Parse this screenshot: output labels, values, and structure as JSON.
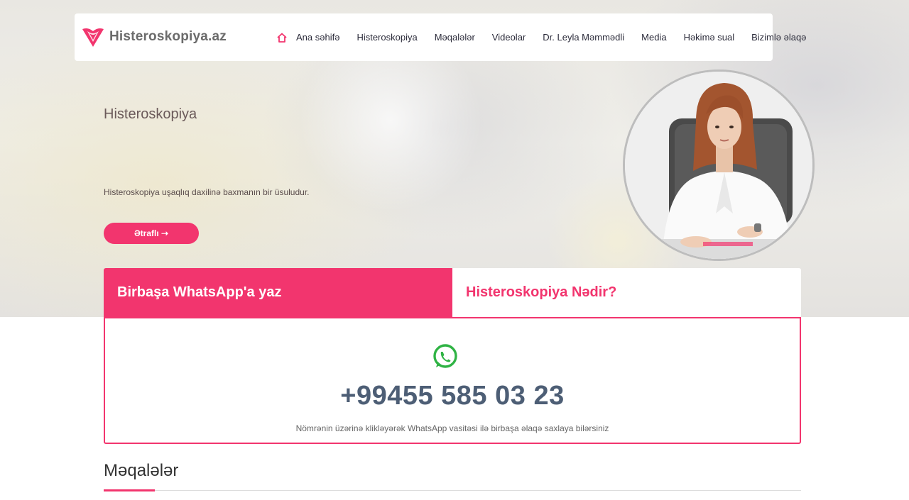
{
  "brand": {
    "name": "Histeroskopiya.az",
    "accent_color": "#f2356e"
  },
  "nav": {
    "items": [
      {
        "label": "Ana səhifə",
        "icon": "home-icon"
      },
      {
        "label": "Histeroskopiya"
      },
      {
        "label": "Məqalələr"
      },
      {
        "label": "Videolar"
      },
      {
        "label": "Dr. Leyla Məmmədli"
      },
      {
        "label": "Media"
      },
      {
        "label": "Həkimə sual"
      },
      {
        "label": "Bizimlə əlaqə"
      }
    ]
  },
  "hero": {
    "title": "Histeroskopiya",
    "description": "Histeroskopiya uşaqlıq daxilinə baxmanın bir üsuludur.",
    "button_label": "Ətraflı ➝"
  },
  "tabs": {
    "whatsapp_label": "Birbaşa WhatsApp'a yaz",
    "what_is_label": "Histeroskopiya Nədir?"
  },
  "whatsapp": {
    "phone": "+99455 585 03 23",
    "note": "Nömrənin üzərinə klikləyərək WhatsApp vasitəsi ilə birbaşa əlaqə saxlaya bilərsiniz",
    "icon": "whatsapp-icon",
    "icon_color": "#2fb344"
  },
  "articles": {
    "heading": "Məqalələr"
  }
}
